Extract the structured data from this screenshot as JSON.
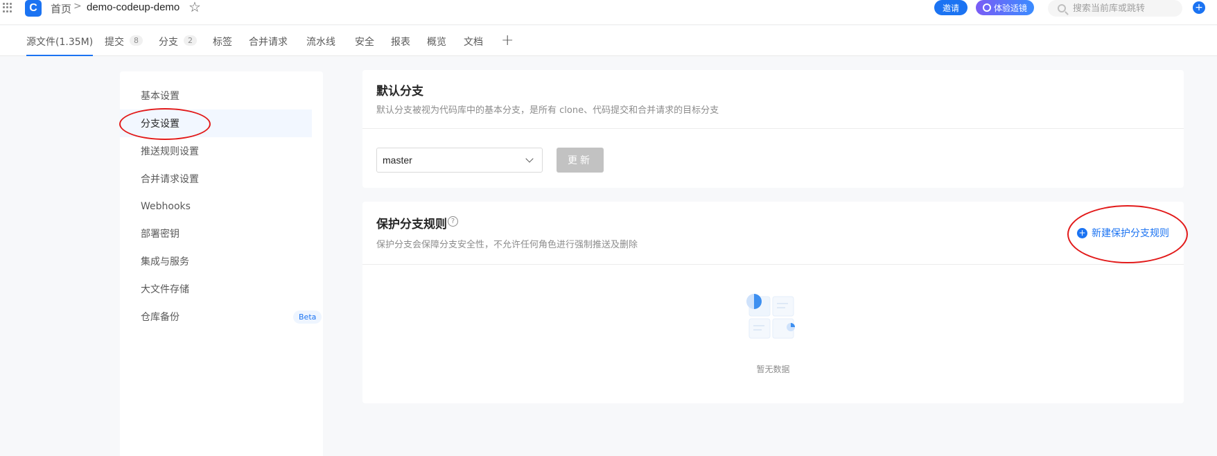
{
  "topbar": {
    "home": "首页",
    "separator": ">",
    "repo_name": "demo-codeup-demo",
    "invite_label": "邀请",
    "trial_label": "体验适镜",
    "search_placeholder": "搜索当前库或跳转",
    "logo_text": "C"
  },
  "tabs": [
    {
      "label": "源文件(1.35M)"
    },
    {
      "label": "提交",
      "count": "8"
    },
    {
      "label": "分支",
      "count": "2"
    },
    {
      "label": "标签"
    },
    {
      "label": "合并请求"
    },
    {
      "label": "流水线"
    },
    {
      "label": "安全"
    },
    {
      "label": "报表"
    },
    {
      "label": "概览"
    },
    {
      "label": "文档"
    }
  ],
  "tab_add": "+",
  "sidebar": {
    "items": [
      {
        "label": "基本设置"
      },
      {
        "label": "分支设置"
      },
      {
        "label": "推送规则设置"
      },
      {
        "label": "合并请求设置"
      },
      {
        "label": "Webhooks"
      },
      {
        "label": "部署密钥"
      },
      {
        "label": "集成与服务"
      },
      {
        "label": "大文件存储"
      },
      {
        "label": "仓库备份"
      }
    ],
    "beta_badge": "Beta"
  },
  "default_branch": {
    "title": "默认分支",
    "description": "默认分支被视为代码库中的基本分支，是所有 clone、代码提交和合并请求的目标分支",
    "selected_branch": "master",
    "update_label": "更新"
  },
  "protected_rules": {
    "title": "保护分支规则",
    "help_symbol": "?",
    "description": "保护分支会保障分支安全性，不允许任何角色进行强制推送及删除",
    "new_rule_label": "新建保护分支规则",
    "empty_text": "暂无数据"
  },
  "colors": {
    "accent": "#1b73f2",
    "annotation": "#e21a1a"
  }
}
